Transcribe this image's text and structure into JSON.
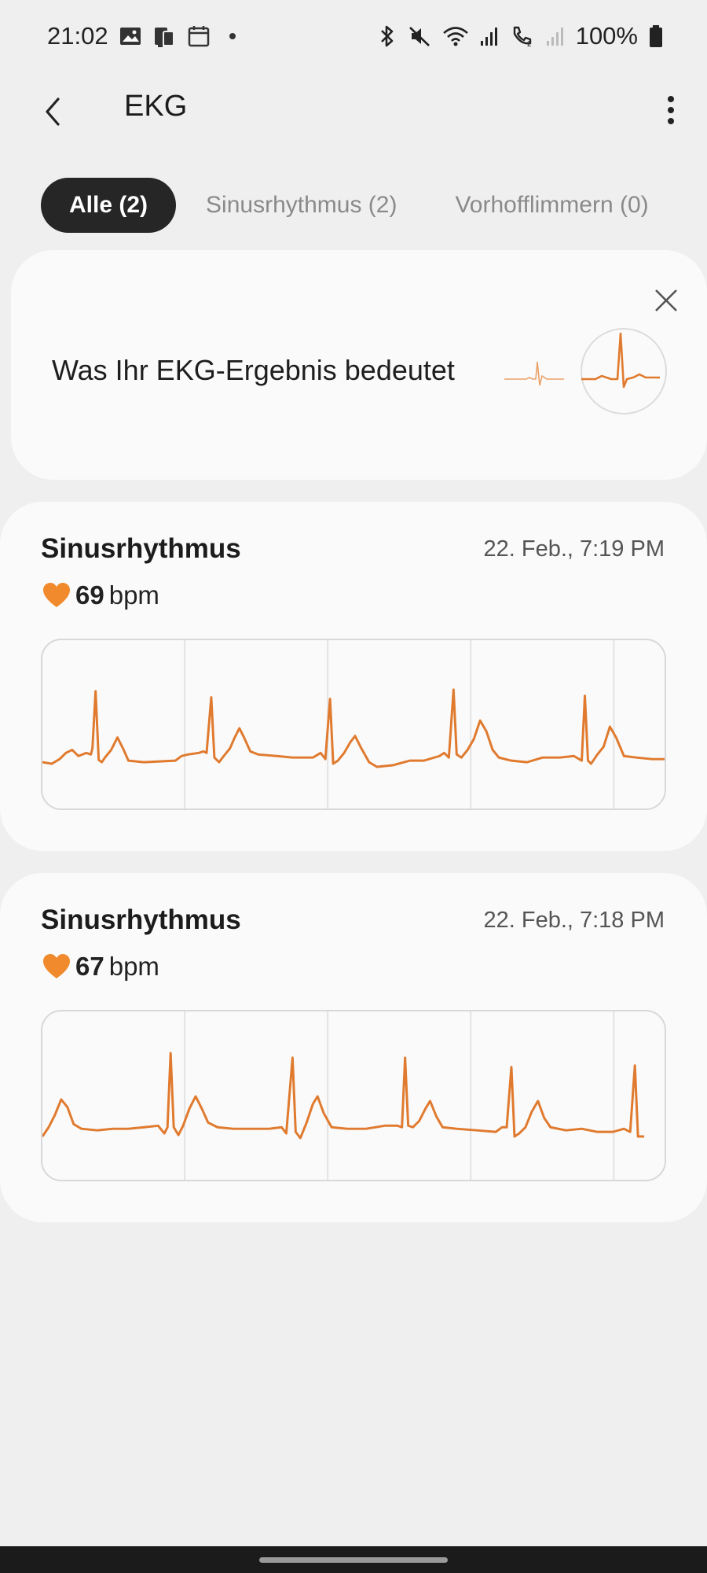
{
  "status_bar": {
    "time": "21:02",
    "battery": "100%",
    "icons_left": [
      "gallery-icon",
      "device-icon",
      "calendar-icon",
      "dot-icon"
    ],
    "icons_right": [
      "bluetooth-icon",
      "mute-icon",
      "wifi-icon",
      "signal-icon",
      "wifi-call-icon",
      "signal-2-icon",
      "battery-icon"
    ]
  },
  "header": {
    "title": "EKG"
  },
  "tabs": [
    {
      "label": "Alle (2)",
      "active": true
    },
    {
      "label": "Sinusrhythmus (2)",
      "active": false
    },
    {
      "label": "Vorhofflimmern (0)",
      "active": false
    }
  ],
  "info_card": {
    "text": "Was Ihr EKG-Ergebnis bedeutet"
  },
  "records": [
    {
      "type": "Sinusrhythmus",
      "date": "22. Feb., 7:19 PM",
      "bpm": "69",
      "unit": "bpm"
    },
    {
      "type": "Sinusrhythmus",
      "date": "22. Feb., 7:18 PM",
      "bpm": "67",
      "unit": "bpm"
    }
  ],
  "colors": {
    "ekg_line": "#e07a2e",
    "heart": "#f08a2c",
    "tab_active_bg": "#262626",
    "card_bg": "#fafafa",
    "page_bg": "#efefef"
  }
}
